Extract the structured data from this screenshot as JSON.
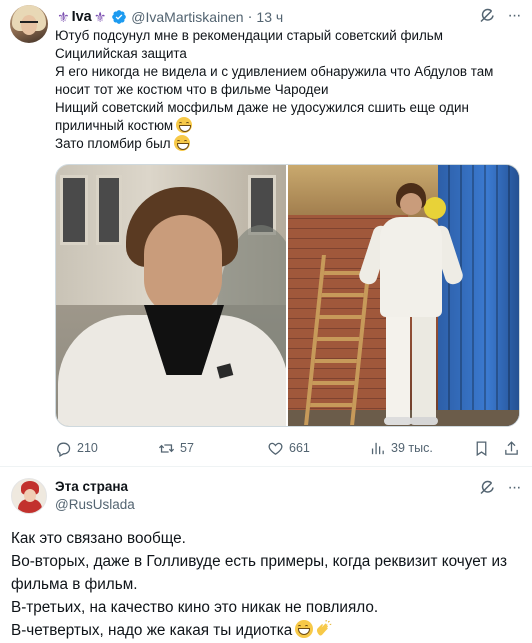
{
  "tweet1": {
    "author_name": "Iva",
    "name_decoration": "⚜",
    "handle": "@IvaMartiskainen",
    "separator": "·",
    "time": "13 ч",
    "lines": [
      "Ютуб подсунул мне в рекомендации старый советский фильм",
      "Сицилийская защита",
      "Я его никогда не видела и с удивлением обнаружила что Абдулов там",
      "носит тот же костюм что в фильме Чародеи",
      "Нищий советский мосфильм даже не удосужился сшить еще один",
      "приличный костюм",
      "Зато пломбир был"
    ],
    "stats": {
      "replies": "210",
      "retweets": "57",
      "likes": "661",
      "views": "39 тыс."
    }
  },
  "tweet2": {
    "author_name": "Эта страна",
    "handle": "@RusUslada",
    "lines": [
      "Как это связано вообще.",
      "Во-вторых, даже в Голливуде есть примеры, когда реквизит кочует из",
      "фильма в фильм.",
      "В-третьих, на качество кино это никак не повлияло.",
      "В-четвертых, надо же какая ты идиотка"
    ]
  },
  "colors": {
    "verified": "#1d9bf0",
    "secondary_text": "#536471",
    "primary_text": "#0f1419",
    "divider": "#eff3f4"
  }
}
